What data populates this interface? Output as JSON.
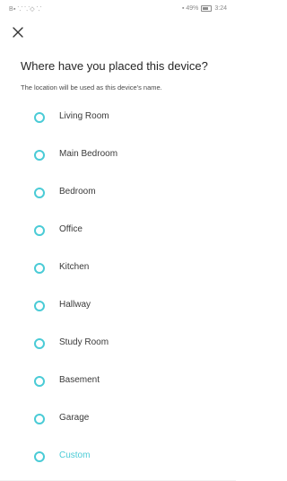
{
  "status_bar": {
    "left_text": "B▪ ⸪ ⸪◇ ⸪",
    "right_text": "▪ 49%",
    "time": "3:24"
  },
  "header": {
    "close_icon": "close-icon",
    "title": "Where have you placed this device?",
    "subtitle": "The location will be used as this device's name."
  },
  "options": [
    {
      "label": "Living Room",
      "accent": false
    },
    {
      "label": "Main Bedroom",
      "accent": false
    },
    {
      "label": "Bedroom",
      "accent": false
    },
    {
      "label": "Office",
      "accent": false
    },
    {
      "label": "Kitchen",
      "accent": false
    },
    {
      "label": "Hallway",
      "accent": false
    },
    {
      "label": "Study Room",
      "accent": false
    },
    {
      "label": "Basement",
      "accent": false
    },
    {
      "label": "Garage",
      "accent": false
    },
    {
      "label": "Custom",
      "accent": true
    }
  ],
  "colors": {
    "accent": "#4acbd6",
    "text": "#262626"
  }
}
